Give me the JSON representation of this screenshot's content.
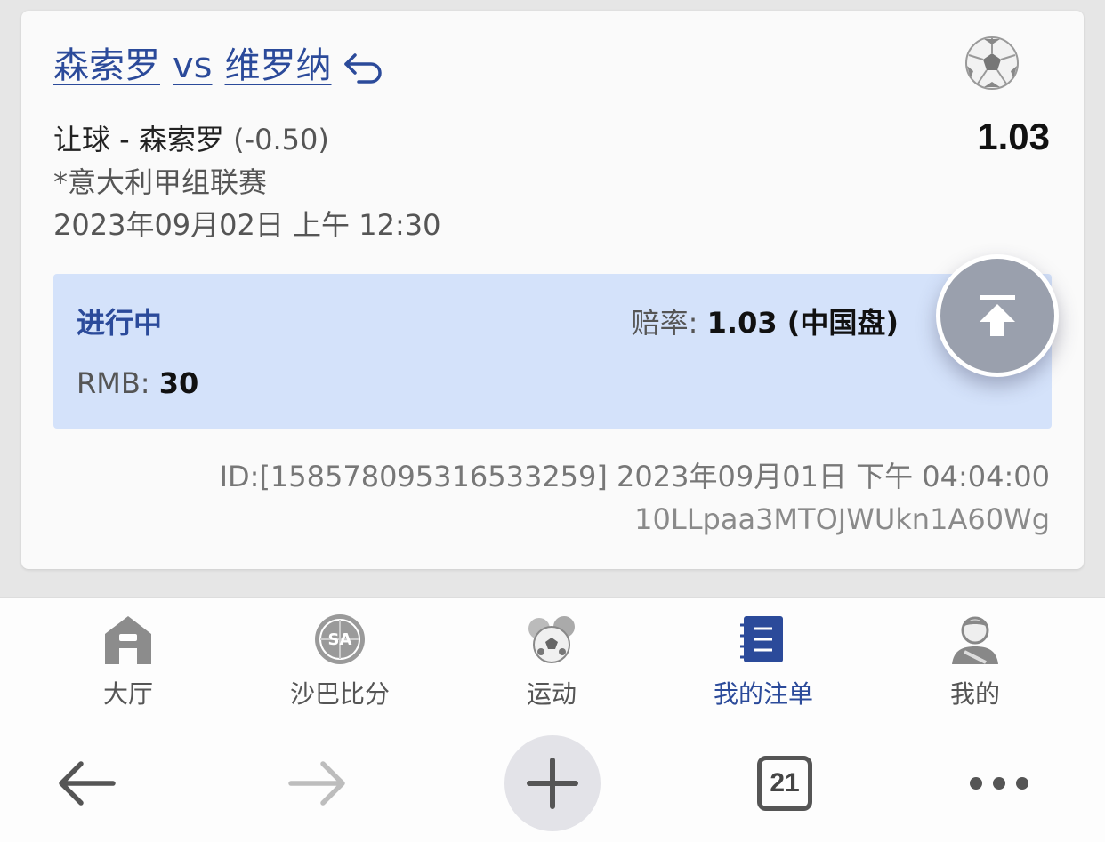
{
  "bet": {
    "home_team": "森索罗",
    "vs": "vs",
    "away_team": "维罗纳",
    "market_line": "让球 - 森索罗",
    "handicap": "(-0.50)",
    "league": "*意大利甲组联赛",
    "match_time": "2023年09月02日 上午 12:30",
    "odds": "1.03",
    "status": "进行中",
    "odds_label": "赔率:",
    "odds_value": "1.03 (中国盘)",
    "stake_label": "RMB:",
    "stake_value": "30",
    "id_line": "ID:[1585780953165332​59] 2023年09月01日 下午 04:04:00",
    "ref_code": "10LLpaa3MTOJWUkn1A60Wg"
  },
  "nav": {
    "items": [
      {
        "label": "大厅",
        "icon": "lobby-icon"
      },
      {
        "label": "沙巴比分",
        "icon": "saba-score-icon"
      },
      {
        "label": "运动",
        "icon": "sports-icon"
      },
      {
        "label": "我的注单",
        "icon": "my-bets-icon",
        "active": true
      },
      {
        "label": "我的",
        "icon": "profile-icon"
      }
    ],
    "active_color": "#2b4a9a",
    "inactive_color": "#555555"
  },
  "browser": {
    "tab_count": "21"
  },
  "colors": {
    "accent": "#2b4a9a",
    "panel_bg": "#d4e2fa"
  }
}
